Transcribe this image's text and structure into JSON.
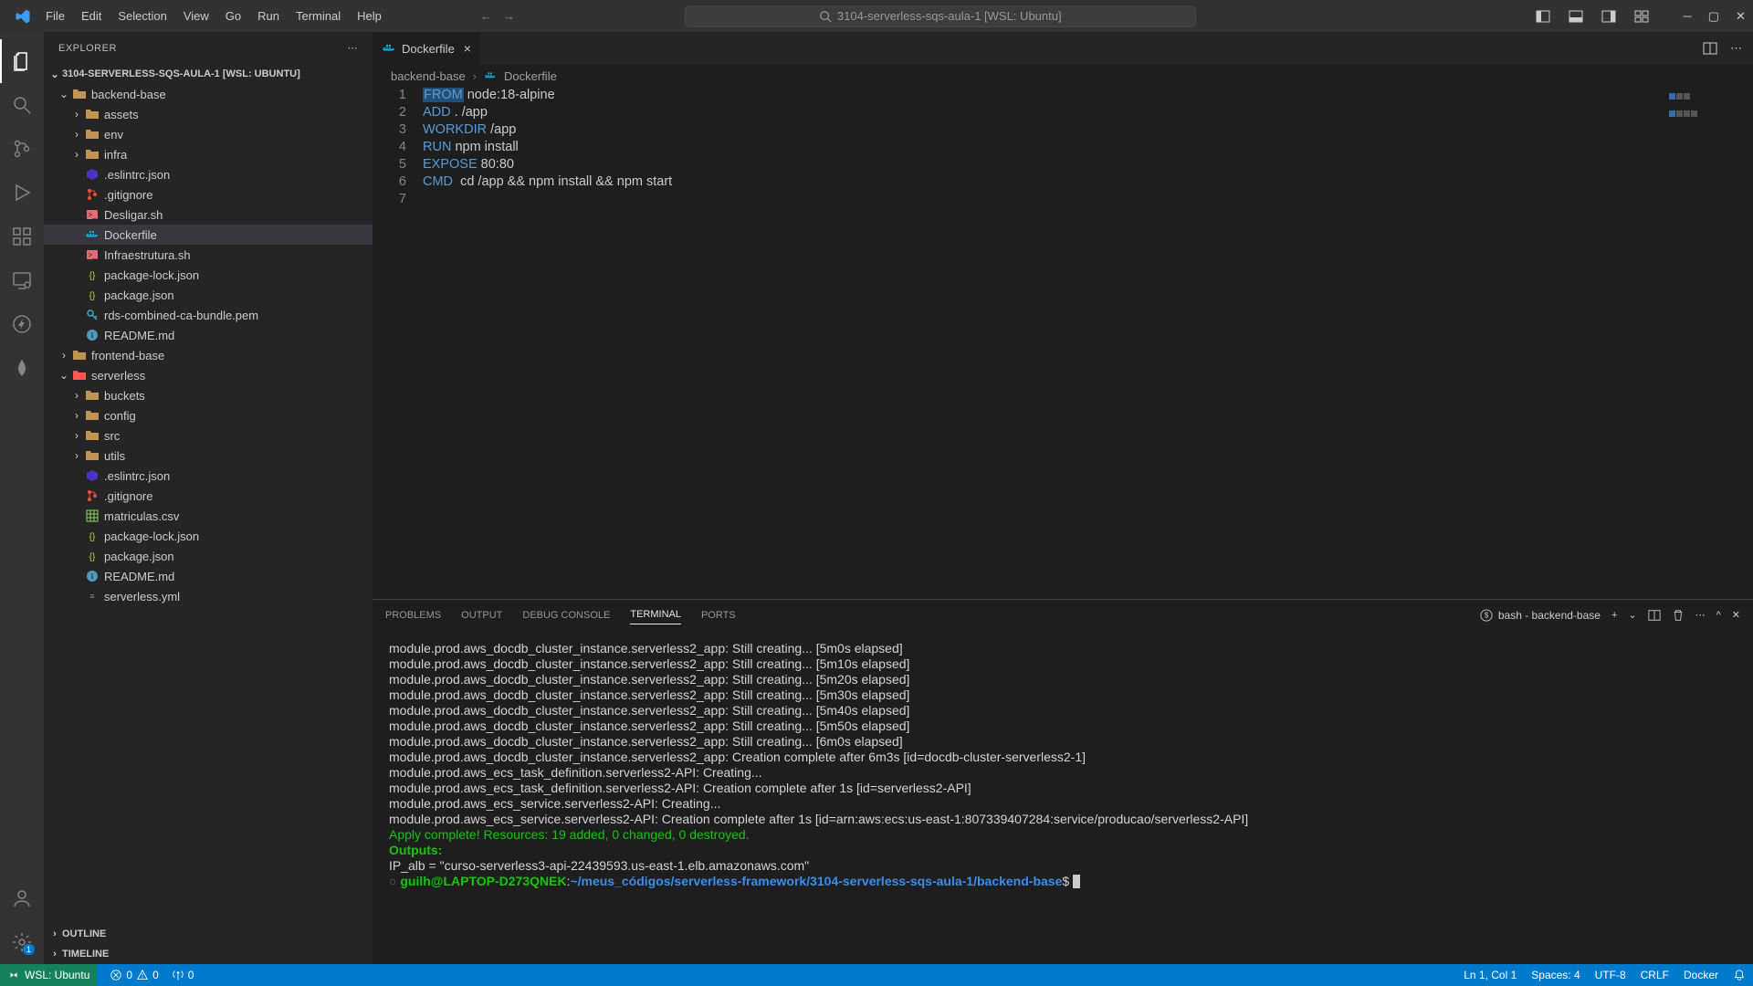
{
  "titlebar": {
    "menus": [
      "File",
      "Edit",
      "Selection",
      "View",
      "Go",
      "Run",
      "Terminal",
      "Help"
    ],
    "search_text": "3104-serverless-sqs-aula-1 [WSL: Ubuntu]"
  },
  "sidebar": {
    "title": "EXPLORER",
    "workspace": "3104-SERVERLESS-SQS-AULA-1 [WSL: UBUNTU]",
    "tree": [
      {
        "label": "backend-base",
        "type": "folder",
        "open": true,
        "indent": 1
      },
      {
        "label": "assets",
        "type": "folder",
        "open": false,
        "indent": 2
      },
      {
        "label": "env",
        "type": "folder",
        "open": false,
        "indent": 2
      },
      {
        "label": "infra",
        "type": "folder",
        "open": false,
        "indent": 2
      },
      {
        "label": ".eslintrc.json",
        "type": "file",
        "icon": "eslint",
        "indent": 2
      },
      {
        "label": ".gitignore",
        "type": "file",
        "icon": "git",
        "indent": 2
      },
      {
        "label": "Desligar.sh",
        "type": "file",
        "icon": "sh",
        "indent": 2
      },
      {
        "label": "Dockerfile",
        "type": "file",
        "icon": "docker",
        "indent": 2,
        "selected": true
      },
      {
        "label": "Infraestrutura.sh",
        "type": "file",
        "icon": "sh",
        "indent": 2
      },
      {
        "label": "package-lock.json",
        "type": "file",
        "icon": "json",
        "indent": 2
      },
      {
        "label": "package.json",
        "type": "file",
        "icon": "json",
        "indent": 2
      },
      {
        "label": "rds-combined-ca-bundle.pem",
        "type": "file",
        "icon": "pem",
        "indent": 2
      },
      {
        "label": "README.md",
        "type": "file",
        "icon": "md",
        "indent": 2
      },
      {
        "label": "frontend-base",
        "type": "folder",
        "open": false,
        "indent": 1
      },
      {
        "label": "serverless",
        "type": "folder-sls",
        "open": true,
        "indent": 1
      },
      {
        "label": "buckets",
        "type": "folder",
        "open": false,
        "indent": 2
      },
      {
        "label": "config",
        "type": "folder",
        "open": false,
        "indent": 2
      },
      {
        "label": "src",
        "type": "folder",
        "open": false,
        "indent": 2
      },
      {
        "label": "utils",
        "type": "folder",
        "open": false,
        "indent": 2
      },
      {
        "label": ".eslintrc.json",
        "type": "file",
        "icon": "eslint",
        "indent": 2
      },
      {
        "label": ".gitignore",
        "type": "file",
        "icon": "git",
        "indent": 2
      },
      {
        "label": "matriculas.csv",
        "type": "file",
        "icon": "csv",
        "indent": 2
      },
      {
        "label": "package-lock.json",
        "type": "file",
        "icon": "json",
        "indent": 2
      },
      {
        "label": "package.json",
        "type": "file",
        "icon": "json",
        "indent": 2
      },
      {
        "label": "README.md",
        "type": "file",
        "icon": "md",
        "indent": 2
      },
      {
        "label": "serverless.yml",
        "type": "file",
        "icon": "yml",
        "indent": 2
      }
    ],
    "outline": "OUTLINE",
    "timeline": "TIMELINE"
  },
  "editor": {
    "tab_label": "Dockerfile",
    "breadcrumb": [
      "backend-base",
      "Dockerfile"
    ],
    "lines": [
      {
        "n": 1,
        "kw": "FROM",
        "rest": " node:18-alpine",
        "hl": true
      },
      {
        "n": 2,
        "kw": "ADD",
        "rest": " . /app"
      },
      {
        "n": 3,
        "kw": "WORKDIR",
        "rest": " /app"
      },
      {
        "n": 4,
        "kw": "RUN",
        "rest": " npm install"
      },
      {
        "n": 5,
        "kw": "EXPOSE",
        "rest": " 80:80"
      },
      {
        "n": 6,
        "kw": "CMD",
        "rest": "  cd /app && npm install && npm start"
      },
      {
        "n": 7,
        "kw": "",
        "rest": ""
      }
    ]
  },
  "panel": {
    "tabs": [
      "PROBLEMS",
      "OUTPUT",
      "DEBUG CONSOLE",
      "TERMINAL",
      "PORTS"
    ],
    "active_tab": "TERMINAL",
    "terminal_label": "bash - backend-base",
    "lines": [
      {
        "cls": "t-white",
        "text": "module.prod.aws_docdb_cluster_instance.serverless2_app: Still creating... [5m0s elapsed]"
      },
      {
        "cls": "t-white",
        "text": "module.prod.aws_docdb_cluster_instance.serverless2_app: Still creating... [5m10s elapsed]"
      },
      {
        "cls": "t-white",
        "text": "module.prod.aws_docdb_cluster_instance.serverless2_app: Still creating... [5m20s elapsed]"
      },
      {
        "cls": "t-white",
        "text": "module.prod.aws_docdb_cluster_instance.serverless2_app: Still creating... [5m30s elapsed]"
      },
      {
        "cls": "t-white",
        "text": "module.prod.aws_docdb_cluster_instance.serverless2_app: Still creating... [5m40s elapsed]"
      },
      {
        "cls": "t-white",
        "text": "module.prod.aws_docdb_cluster_instance.serverless2_app: Still creating... [5m50s elapsed]"
      },
      {
        "cls": "t-white",
        "text": "module.prod.aws_docdb_cluster_instance.serverless2_app: Still creating... [6m0s elapsed]"
      },
      {
        "cls": "t-white",
        "text": "module.prod.aws_docdb_cluster_instance.serverless2_app: Creation complete after 6m3s [id=docdb-cluster-serverless2-1]"
      },
      {
        "cls": "t-white",
        "text": "module.prod.aws_ecs_task_definition.serverless2-API: Creating..."
      },
      {
        "cls": "t-white",
        "text": "module.prod.aws_ecs_task_definition.serverless2-API: Creation complete after 1s [id=serverless2-API]"
      },
      {
        "cls": "t-white",
        "text": "module.prod.aws_ecs_service.serverless2-API: Creating..."
      },
      {
        "cls": "t-white",
        "text": "module.prod.aws_ecs_service.serverless2-API: Creation complete after 1s [id=arn:aws:ecs:us-east-1:807339407284:service/producao/serverless2-API]"
      },
      {
        "cls": "",
        "text": ""
      },
      {
        "cls": "t-green",
        "text": "Apply complete! Resources: 19 added, 0 changed, 0 destroyed."
      },
      {
        "cls": "",
        "text": ""
      },
      {
        "cls": "t-greenb",
        "text": "Outputs:"
      },
      {
        "cls": "",
        "text": ""
      },
      {
        "cls": "t-white",
        "text": "IP_alb = \"curso-serverless3-api-22439593.us-east-1.elb.amazonaws.com\""
      }
    ],
    "prompt_user": "guilh@LAPTOP-D273QNEK",
    "prompt_sep": ":",
    "prompt_path": "~/meus_códigos/serverless-framework/3104-serverless-sqs-aula-1/backend-base",
    "prompt_end": "$"
  },
  "statusbar": {
    "remote": "WSL: Ubuntu",
    "errors": "0",
    "warnings": "0",
    "ports": "0",
    "ln_col": "Ln 1, Col 1",
    "spaces": "Spaces: 4",
    "encoding": "UTF-8",
    "eol": "CRLF",
    "lang": "Docker"
  }
}
